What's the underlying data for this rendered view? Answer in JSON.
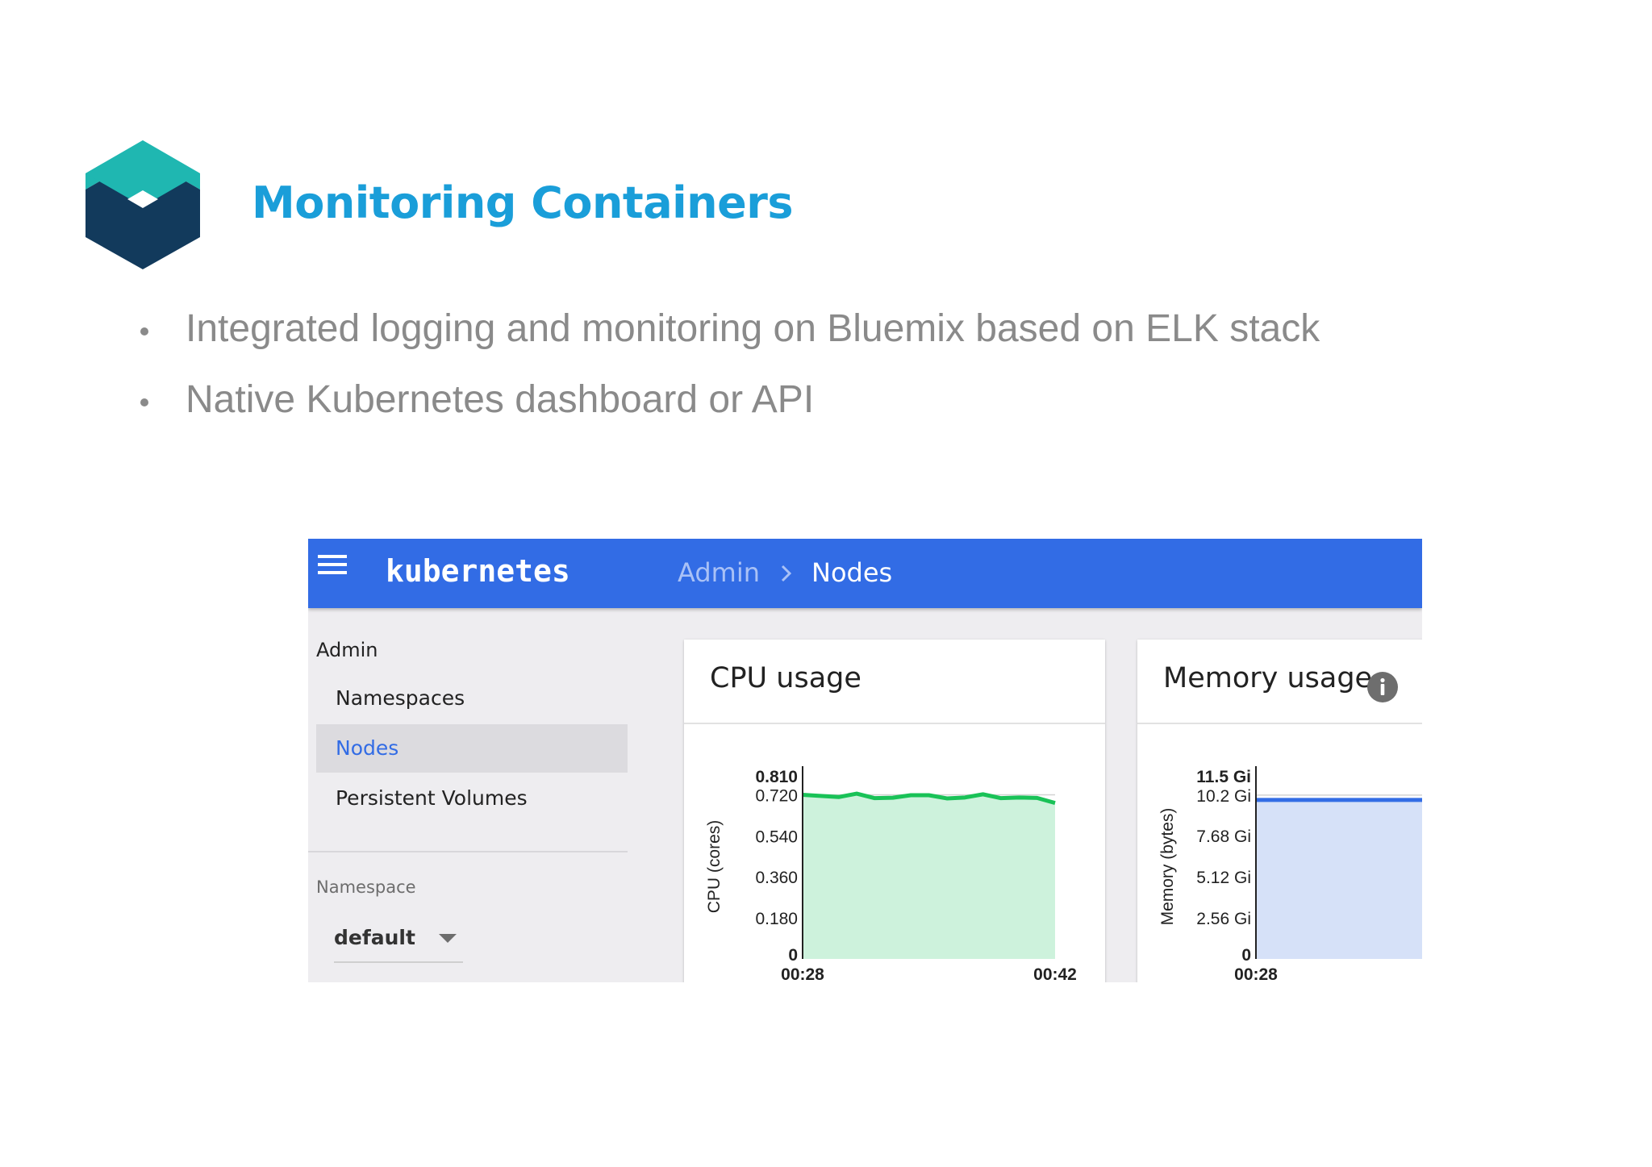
{
  "slide": {
    "title": "Monitoring Containers",
    "bullets": [
      "Integrated logging and monitoring on Bluemix based on ELK stack",
      "Native Kubernetes dashboard or API"
    ],
    "logo_icon": "stacked-cube-logo-icon",
    "title_color": "#1a9ed9",
    "logo_colors": {
      "top": "#1fb7b1",
      "bottom": "#123a5c"
    }
  },
  "dashboard": {
    "brand": "kubernetes",
    "menu_icon": "hamburger-menu-icon",
    "topbar_color": "#326ce5",
    "breadcrumb": {
      "parent": "Admin",
      "separator_icon": "chevron-right-icon",
      "current": "Nodes"
    },
    "sidebar": {
      "section": "Admin",
      "items": [
        {
          "label": "Namespaces",
          "active": false
        },
        {
          "label": "Nodes",
          "active": true
        },
        {
          "label": "Persistent Volumes",
          "active": false
        }
      ],
      "namespace_label": "Namespace",
      "namespace_value": "default",
      "namespace_caret_icon": "dropdown-caret-icon"
    },
    "cpu_card": {
      "title": "CPU usage"
    },
    "memory_card": {
      "title": "Memory usage",
      "info_icon": "info-icon"
    }
  },
  "chart_data": [
    {
      "type": "area",
      "ylabel": "CPU (cores)",
      "y_ticks": [
        "0.810",
        "0.720",
        "0.540",
        "0.360",
        "0.180",
        "0"
      ],
      "y_tick_values": [
        0.81,
        0.72,
        0.54,
        0.36,
        0.18,
        0
      ],
      "x_ticks": [
        "00:28",
        "00:42"
      ],
      "ylim": [
        0,
        0.81
      ],
      "grid": true,
      "series": [
        {
          "color": "#19c257",
          "fill": "#cdf2dc",
          "values": [
            0.72,
            0.715,
            0.71,
            0.725,
            0.705,
            0.707,
            0.718,
            0.718,
            0.704,
            0.708,
            0.722,
            0.705,
            0.708,
            0.706,
            0.684
          ]
        }
      ]
    },
    {
      "type": "area",
      "ylabel": "Memory (bytes)",
      "y_ticks": [
        "11.5 Gi",
        "10.2 Gi",
        "7.68 Gi",
        "5.12 Gi",
        "2.56 Gi",
        "0"
      ],
      "y_tick_values": [
        11.5,
        10.2,
        7.68,
        5.12,
        2.56,
        0
      ],
      "x_ticks": [
        "00:28"
      ],
      "ylim": [
        0,
        11.5
      ],
      "grid": true,
      "series": [
        {
          "color": "#326ce5",
          "fill": "#d6e1f8",
          "values": [
            9.9,
            9.9,
            9.9,
            9.9
          ]
        }
      ]
    }
  ]
}
